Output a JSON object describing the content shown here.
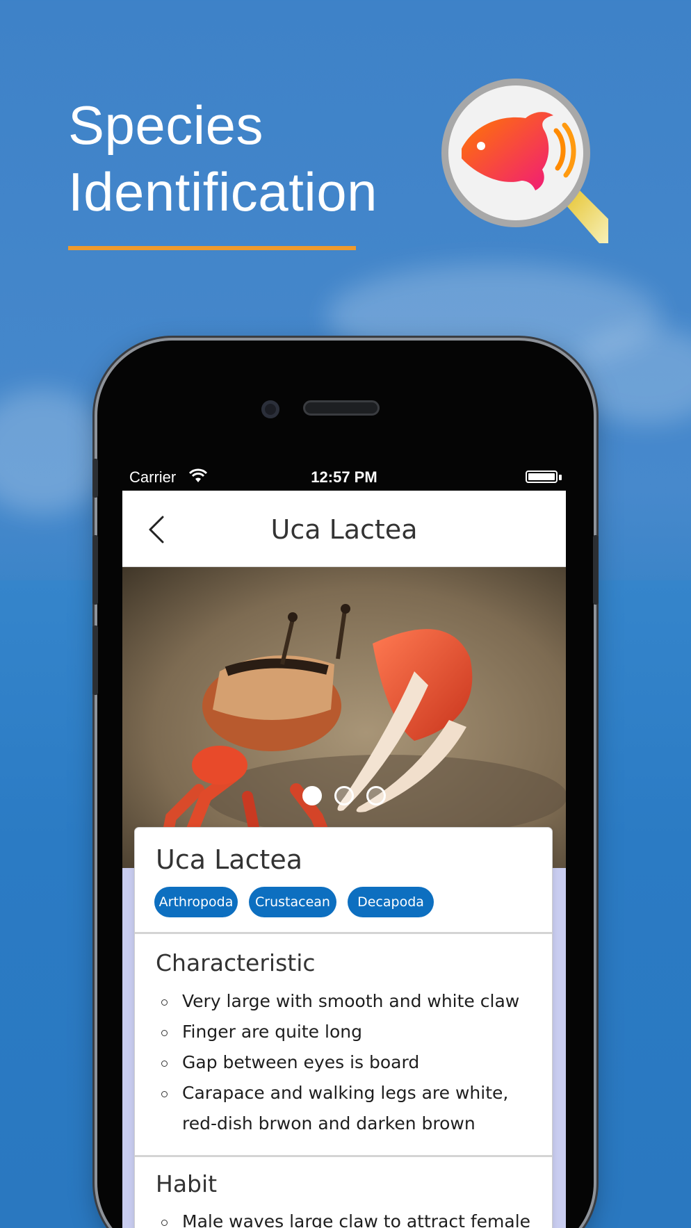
{
  "hero": {
    "title_line1": "Species",
    "title_line2": "Identification",
    "accent_color": "#ef9a2c",
    "logo_icon": "fish-magnifier-icon"
  },
  "status_bar": {
    "carrier": "Carrier",
    "time": "12:57 PM",
    "wifi_icon": "wifi-icon",
    "battery_icon": "battery-icon"
  },
  "nav": {
    "back_icon": "chevron-left-icon",
    "title": "Uca Lactea"
  },
  "gallery": {
    "image_subject": "fiddler crab",
    "page_count": 3,
    "active_page": 1
  },
  "species": {
    "name": "Uca Lactea",
    "tags": [
      "Arthropoda",
      "Crustacean",
      "Decapoda"
    ],
    "tag_color": "#0d6fc0"
  },
  "characteristic": {
    "heading": "Characteristic",
    "items": [
      "Very large with smooth and white claw",
      "Finger are quite long",
      "Gap between eyes is board",
      "Carapace and walking legs are white, red-dish brwon and darken brown"
    ]
  },
  "habit": {
    "heading": "Habit",
    "items": [
      "Male waves large claw to attract female"
    ]
  }
}
